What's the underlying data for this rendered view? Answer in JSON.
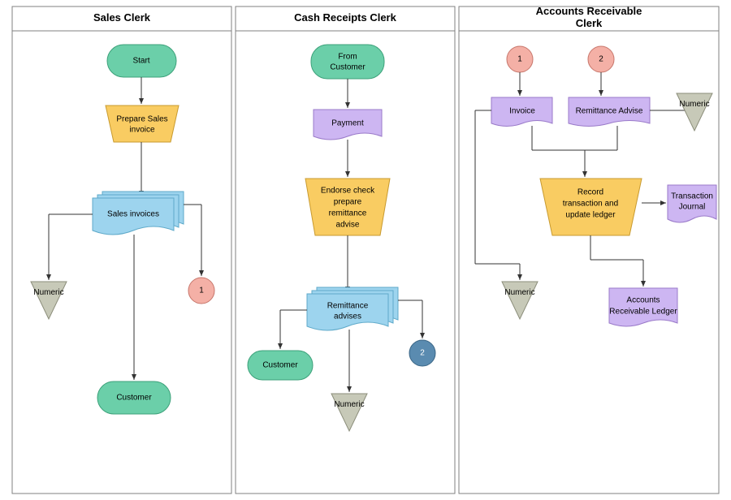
{
  "lanes": {
    "sales": "Sales Clerk",
    "cash": "Cash Receipts Clerk",
    "ar": "Accounts Receivable Clerk"
  },
  "sales": {
    "start": "Start",
    "prepare": "Prepare Sales invoice",
    "invoices": "Sales invoices",
    "file": "Numeric",
    "conn1": "1",
    "customer": "Customer"
  },
  "cash": {
    "from": "From Customer",
    "payment": "Payment",
    "endorse": "Endorse check prepare remittance advise",
    "remittance": "Remittance advises",
    "customer": "Customer",
    "file": "Numeric",
    "conn2": "2"
  },
  "ar": {
    "conn1": "1",
    "conn2": "2",
    "invoice": "Invoice",
    "ra": "Remittance Advise",
    "file1": "Numeric",
    "record": "Record transaction and update ledger",
    "journal": "Transaction Journal",
    "file2": "Numeric",
    "ledger": "Accounts Receivable Ledger"
  },
  "colors": {
    "green": "#6bcfa9",
    "greenStroke": "#3da17a",
    "yellow": "#f9cc62",
    "yellowStroke": "#c89a2f",
    "blue": "#9dd4ee",
    "blueStroke": "#5ea9c9",
    "purple": "#cdb6f2",
    "purpleStroke": "#9a7ac9",
    "pink": "#f4b0a6",
    "pinkStroke": "#c7766b",
    "navy": "#5a8bb0",
    "navyStroke": "#3a6585",
    "grey": "#c7c9b8",
    "greyStroke": "#8b8d7a",
    "border": "#808080"
  }
}
